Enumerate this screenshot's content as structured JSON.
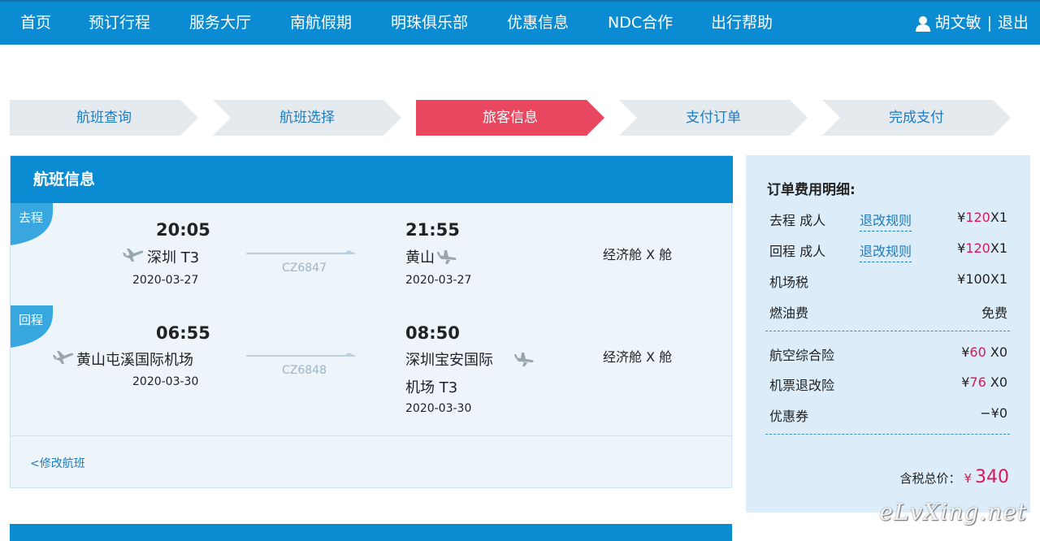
{
  "nav": {
    "items": [
      "首页",
      "预订行程",
      "服务大厅",
      "南航假期",
      "明珠俱乐部",
      "优惠信息",
      "NDC合作",
      "出行帮助"
    ],
    "user_name": "胡文敏",
    "separator": "|",
    "logout": "退出"
  },
  "steps": {
    "items": [
      "航班查询",
      "航班选择",
      "旅客信息",
      "支付订单",
      "完成支付"
    ],
    "active_index": 2
  },
  "flight": {
    "title": "航班信息",
    "outbound": {
      "badge": "去程",
      "dep_time": "20:05",
      "dep_city": "深圳 T3",
      "dep_date": "2020-03-27",
      "flight_no": "CZ6847",
      "arr_time": "21:55",
      "arr_city": "黄山",
      "arr_date": "2020-03-27",
      "cabin": "经济舱  X 舱"
    },
    "return": {
      "badge": "回程",
      "dep_time": "06:55",
      "dep_city": "黄山屯溪国际机场",
      "dep_date": "2020-03-30",
      "flight_no": "CZ6848",
      "arr_time": "08:50",
      "arr_city_line1": "深圳宝安国际",
      "arr_city_line2": "机场 T3",
      "arr_date": "2020-03-30",
      "cabin": "经济舱  X 舱"
    },
    "modify": "<修改航班"
  },
  "fees": {
    "title": "订单费用明细:",
    "rows": [
      {
        "label": "去程 成人",
        "rule": "退改规则",
        "cur": "¥",
        "amount": "120",
        "mult": "X1"
      },
      {
        "label": "回程 成人",
        "rule": "退改规则",
        "cur": "¥",
        "amount": "120",
        "mult": "X1"
      },
      {
        "label": "机场税",
        "value": "¥100X1"
      },
      {
        "label": "燃油费",
        "value": "免费"
      },
      {
        "label": "航空综合险",
        "cur": "¥",
        "amount": "60",
        "mult": " X0"
      },
      {
        "label": "机票退改险",
        "cur": "¥",
        "amount": "76",
        "mult": " X0"
      },
      {
        "label": "优惠券",
        "value": "−¥0"
      }
    ],
    "total_label": "含税总价：",
    "total_currency": "¥",
    "total_amount": "340"
  },
  "watermark": "eLvXing.net",
  "colors": {
    "primary": "#0b8bd1",
    "active_step": "#e8475f",
    "step_bg": "#e5eaef",
    "price_red": "#d6185a",
    "fee_bg": "#dcedf9"
  }
}
